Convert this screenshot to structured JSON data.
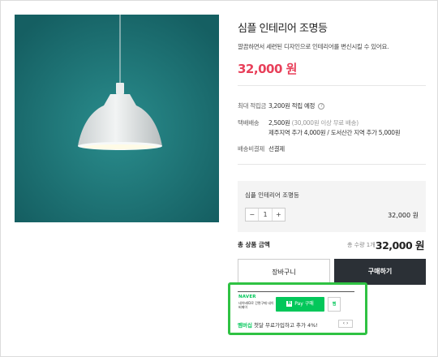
{
  "product": {
    "title": "심플 인테리어 조명등",
    "description": "깔끔하면서 세련된 디자인으로 인테리어를 변신시킬 수 있어요.",
    "price": "32,000 원"
  },
  "info_rows": {
    "points": {
      "label": "최대 적립금",
      "value": "3,200원 적립 예정",
      "help_icon": "question-icon"
    },
    "shipping": {
      "label": "택배배송",
      "value": "2,500원",
      "note": "(30,000원 이상 무료 배송)",
      "extra": "제주지역 추가 4,000원 / 도서산간 지역 추가 5,000원"
    },
    "shipping_payment": {
      "label": "배송비결제",
      "value": "선결제"
    }
  },
  "option": {
    "name": "심플 인테리어 조명등",
    "minus": "−",
    "quantity": "1",
    "plus": "+",
    "price": "32,000 원"
  },
  "total": {
    "label": "총 상품 금액",
    "quantity": "총 수량 1개",
    "price": "32,000 원"
  },
  "buttons": {
    "cart": "장바구니",
    "buy": "구매하기"
  },
  "naver": {
    "logo": "NAVER",
    "text": "네이버ID로 간편구매 네이버페이",
    "pay_n": "N",
    "pay_label": "Pay 구매",
    "wish_label": "찜",
    "promo_highlight": "멤버십",
    "promo_text": " 첫달 무료가입하고 추가 4%!",
    "promo_nav": "‹ ›"
  },
  "colors": {
    "accent_price": "#e8405a",
    "buy_button": "#2b3036",
    "naver_green": "#03c75a",
    "highlight_outline": "#2fc243",
    "image_background": "#1f7f80"
  }
}
